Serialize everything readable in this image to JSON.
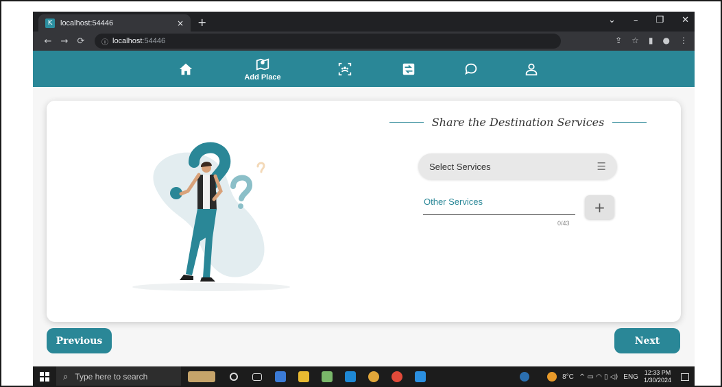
{
  "browser": {
    "tab_title": "localhost:54446",
    "tab_close": "×",
    "new_tab": "+",
    "url_host": "localhost",
    "url_port": ":54446",
    "window_controls": [
      "⌄",
      "–",
      "❐",
      "✕"
    ]
  },
  "app_nav": {
    "items": [
      {
        "icon": "home-icon",
        "label": ""
      },
      {
        "icon": "map-pin-icon",
        "label": "Add Place"
      },
      {
        "icon": "group-icon",
        "label": ""
      },
      {
        "icon": "swap-image-icon",
        "label": ""
      },
      {
        "icon": "chat-icon",
        "label": ""
      },
      {
        "icon": "user-icon",
        "label": ""
      }
    ],
    "color": "#2a8797"
  },
  "form": {
    "heading": "Share the Destination Services",
    "select_placeholder": "Select Services",
    "other_label": "Other Services",
    "char_count": "0/43",
    "add_label": "+"
  },
  "footer": {
    "previous_label": "Previous",
    "next_label": "Next"
  },
  "taskbar": {
    "search_placeholder": "Type here to search",
    "weather": "8°C",
    "language": "ENG",
    "time": "12:33 PM",
    "date": "1/30/2024"
  }
}
